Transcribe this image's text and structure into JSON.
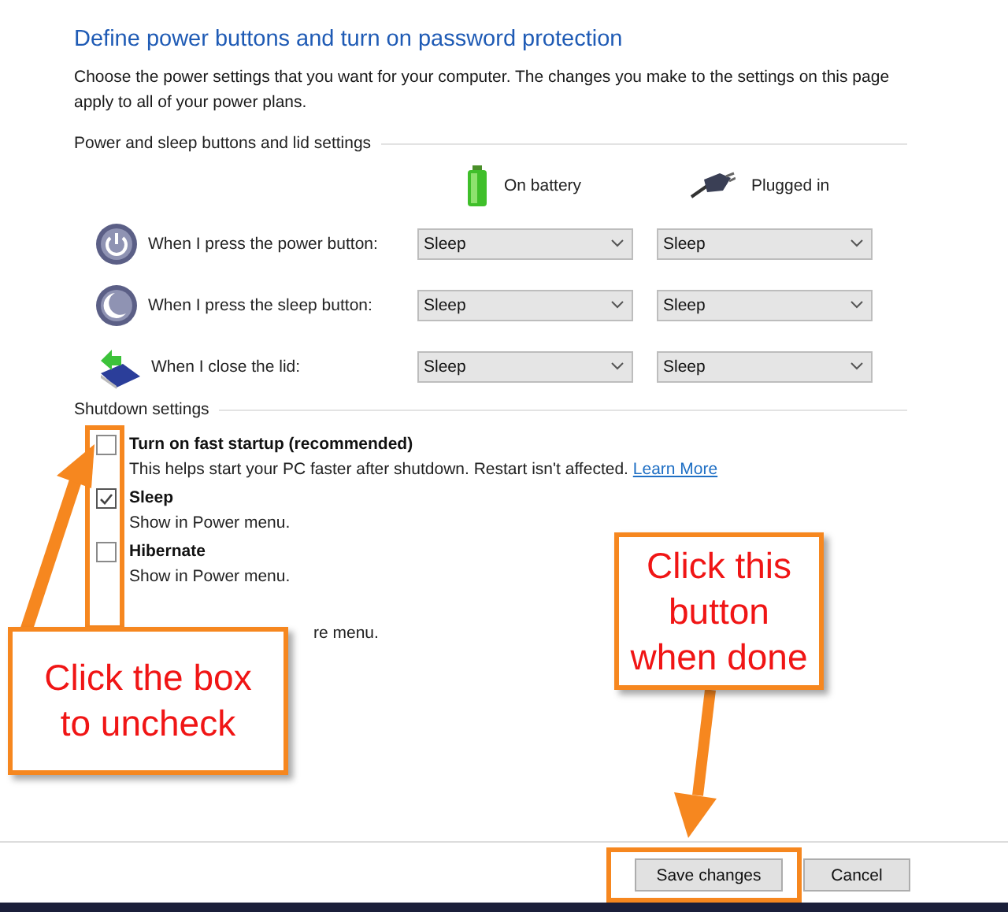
{
  "title": "Define power buttons and turn on password protection",
  "description": "Choose the power settings that you want for your computer. The changes you make to the settings on this page apply to all of your power plans.",
  "power_section": {
    "heading": "Power and sleep buttons and lid settings",
    "columns": [
      {
        "kind": "battery",
        "label": "On battery"
      },
      {
        "kind": "plug",
        "label": "Plugged in"
      }
    ],
    "rows": [
      {
        "kind": "power",
        "label": "When I press the power button:",
        "values": [
          "Sleep",
          "Sleep"
        ]
      },
      {
        "kind": "sleep",
        "label": "When I press the sleep button:",
        "values": [
          "Sleep",
          "Sleep"
        ]
      },
      {
        "kind": "lid",
        "label": "When I close the lid:",
        "values": [
          "Sleep",
          "Sleep"
        ]
      }
    ]
  },
  "shutdown_section": {
    "heading": "Shutdown settings",
    "options": [
      {
        "kind": "checkbox",
        "label": "Turn on fast startup (recommended)",
        "checked": false,
        "description": "This helps start your PC faster after shutdown. Restart isn't affected.",
        "link": "Learn More"
      },
      {
        "kind": "checkbox",
        "label": "Sleep",
        "checked": true,
        "description": "Show in Power menu."
      },
      {
        "kind": "checkbox",
        "label": "Hibernate",
        "checked": false,
        "description": "Show in Power menu."
      },
      {
        "kind": "covered",
        "description": "re menu."
      }
    ]
  },
  "buttons": [
    {
      "label": "Save changes",
      "highlighted": true
    },
    {
      "label": "Cancel",
      "highlighted": false
    }
  ],
  "annotations": [
    {
      "kind": "left",
      "text": "Click the box\nto uncheck"
    },
    {
      "kind": "right",
      "text": "Click this\nbutton\nwhen done"
    }
  ]
}
